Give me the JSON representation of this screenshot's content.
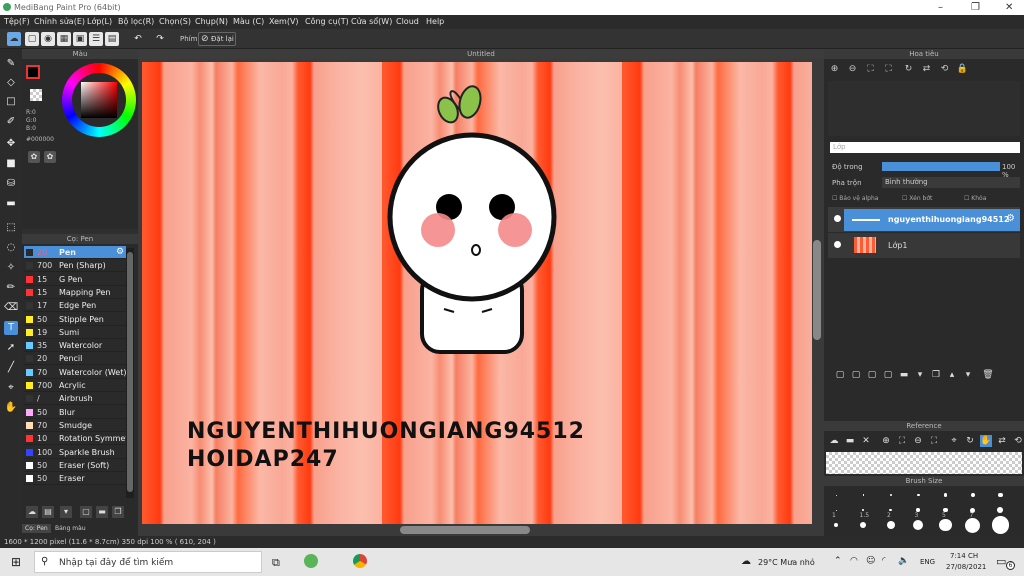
{
  "window": {
    "title": "MediBang Paint Pro (64bit)"
  },
  "menu": [
    "Tệp(F)",
    "Chỉnh sửa(E)",
    "Lớp(L)",
    "Bộ lọc(R)",
    "Chọn(S)",
    "Chụp(N)",
    "Màu (C)",
    "Xem(V)",
    "Công cụ(T)",
    "Cửa sổ(W)",
    "Cloud",
    "Help"
  ],
  "toolbar": {
    "brush_label": "Phím",
    "reset_label": "Đặt lại"
  },
  "color_panel": {
    "title": "Màu",
    "r": "R:0",
    "g": "G:0",
    "b": "B:0",
    "hex": "#000000"
  },
  "brush_panel": {
    "title": "Cọ: Pen",
    "tabs": [
      "Cọ: Pen",
      "Bảng màu"
    ],
    "items": [
      {
        "size": "20",
        "name": "Pen",
        "color": "#2a2a2a"
      },
      {
        "size": "700",
        "name": "Pen (Sharp)",
        "color": "#333333"
      },
      {
        "size": "15",
        "name": "G Pen",
        "color": "#ff3333"
      },
      {
        "size": "15",
        "name": "Mapping Pen",
        "color": "#ff3333"
      },
      {
        "size": "17",
        "name": "Edge Pen",
        "color": "#333333"
      },
      {
        "size": "50",
        "name": "Stipple Pen",
        "color": "#ffee22"
      },
      {
        "size": "19",
        "name": "Sumi",
        "color": "#ffee22"
      },
      {
        "size": "35",
        "name": "Watercolor",
        "color": "#66ccff"
      },
      {
        "size": "20",
        "name": "Pencil",
        "color": "#333333"
      },
      {
        "size": "70",
        "name": "Watercolor (Wet)",
        "color": "#66ccff"
      },
      {
        "size": "700",
        "name": "Acrylic",
        "color": "#ffee22"
      },
      {
        "size": "/",
        "name": "Airbrush",
        "color": "#333333"
      },
      {
        "size": "50",
        "name": "Blur",
        "color": "#ffaaff"
      },
      {
        "size": "70",
        "name": "Smudge",
        "color": "#ffddbb"
      },
      {
        "size": "10",
        "name": "Rotation Symmetry",
        "color": "#ff3333"
      },
      {
        "size": "100",
        "name": "Sparkle Brush",
        "color": "#3344ff"
      },
      {
        "size": "50",
        "name": "Eraser (Soft)",
        "color": "#ffffff"
      },
      {
        "size": "50",
        "name": "Eraser",
        "color": "#ffffff"
      }
    ]
  },
  "canvas": {
    "tab_title": "Untitled",
    "watermark_line1": "NGUYENTHIHUONGIANG94512",
    "watermark_line2": "HOIDAP247"
  },
  "navigator": {
    "title": "Hoa tiêu"
  },
  "layers": {
    "title": "Lớp",
    "opacity_label": "Độ trong",
    "opacity_value": "100 %",
    "opacity_fraction": 1.0,
    "blend_label": "Pha trộn",
    "blend_value": "Bình thường",
    "protect_alpha": "Bảo vệ alpha",
    "clipping": "Xén bớt",
    "lock": "Khóa",
    "items": [
      {
        "name": "nguyenthihuongiang94512",
        "selected": true
      },
      {
        "name": "Lớp1",
        "selected": false
      }
    ]
  },
  "reference": {
    "title": "Reference"
  },
  "brush_size": {
    "title": "Brush Size",
    "labels": [
      "1",
      "1.5",
      "2",
      "3",
      "5",
      "7"
    ]
  },
  "status": {
    "text": "1600 * 1200 pixel  (11.6 * 8.7cm)  350 dpi  100 %  ( 610, 204 )"
  },
  "taskbar": {
    "search_placeholder": "Nhập tại đây để tìm kiếm",
    "weather": "29°C  Mưa nhỏ",
    "lang": "ENG",
    "time": "7:14 CH",
    "date": "27/08/2021",
    "notif": "6"
  }
}
